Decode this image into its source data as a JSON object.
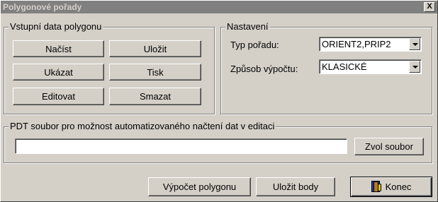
{
  "window": {
    "title": "Polygonové pořady",
    "close_label": "X"
  },
  "input_group": {
    "label": "Vstupní data polygonu",
    "buttons": {
      "load": {
        "label": "Načíst"
      },
      "save": {
        "label": "Uložit"
      },
      "show": {
        "label": "Ukázat"
      },
      "print": {
        "label": "Tisk"
      },
      "edit": {
        "label": "Editovat"
      },
      "delete": {
        "label": "Smazat"
      }
    }
  },
  "settings_group": {
    "label": "Nastavení",
    "traverse_type": {
      "label": "Typ pořadu:",
      "value": "ORIENT2,PRIP2"
    },
    "calc_method": {
      "label": "Způsob výpočtu:",
      "value": "KLASICKÉ"
    }
  },
  "pdt_group": {
    "label": "PDT soubor pro možnost automatizovaného načtení dat v editaci",
    "file_value": "",
    "choose_file_label": "Zvol soubor"
  },
  "footer": {
    "compute_label": "Výpočet polygonu",
    "save_points_label": "Uložit body",
    "exit_label": "Konec",
    "exit_icon": "exit-door-icon"
  }
}
